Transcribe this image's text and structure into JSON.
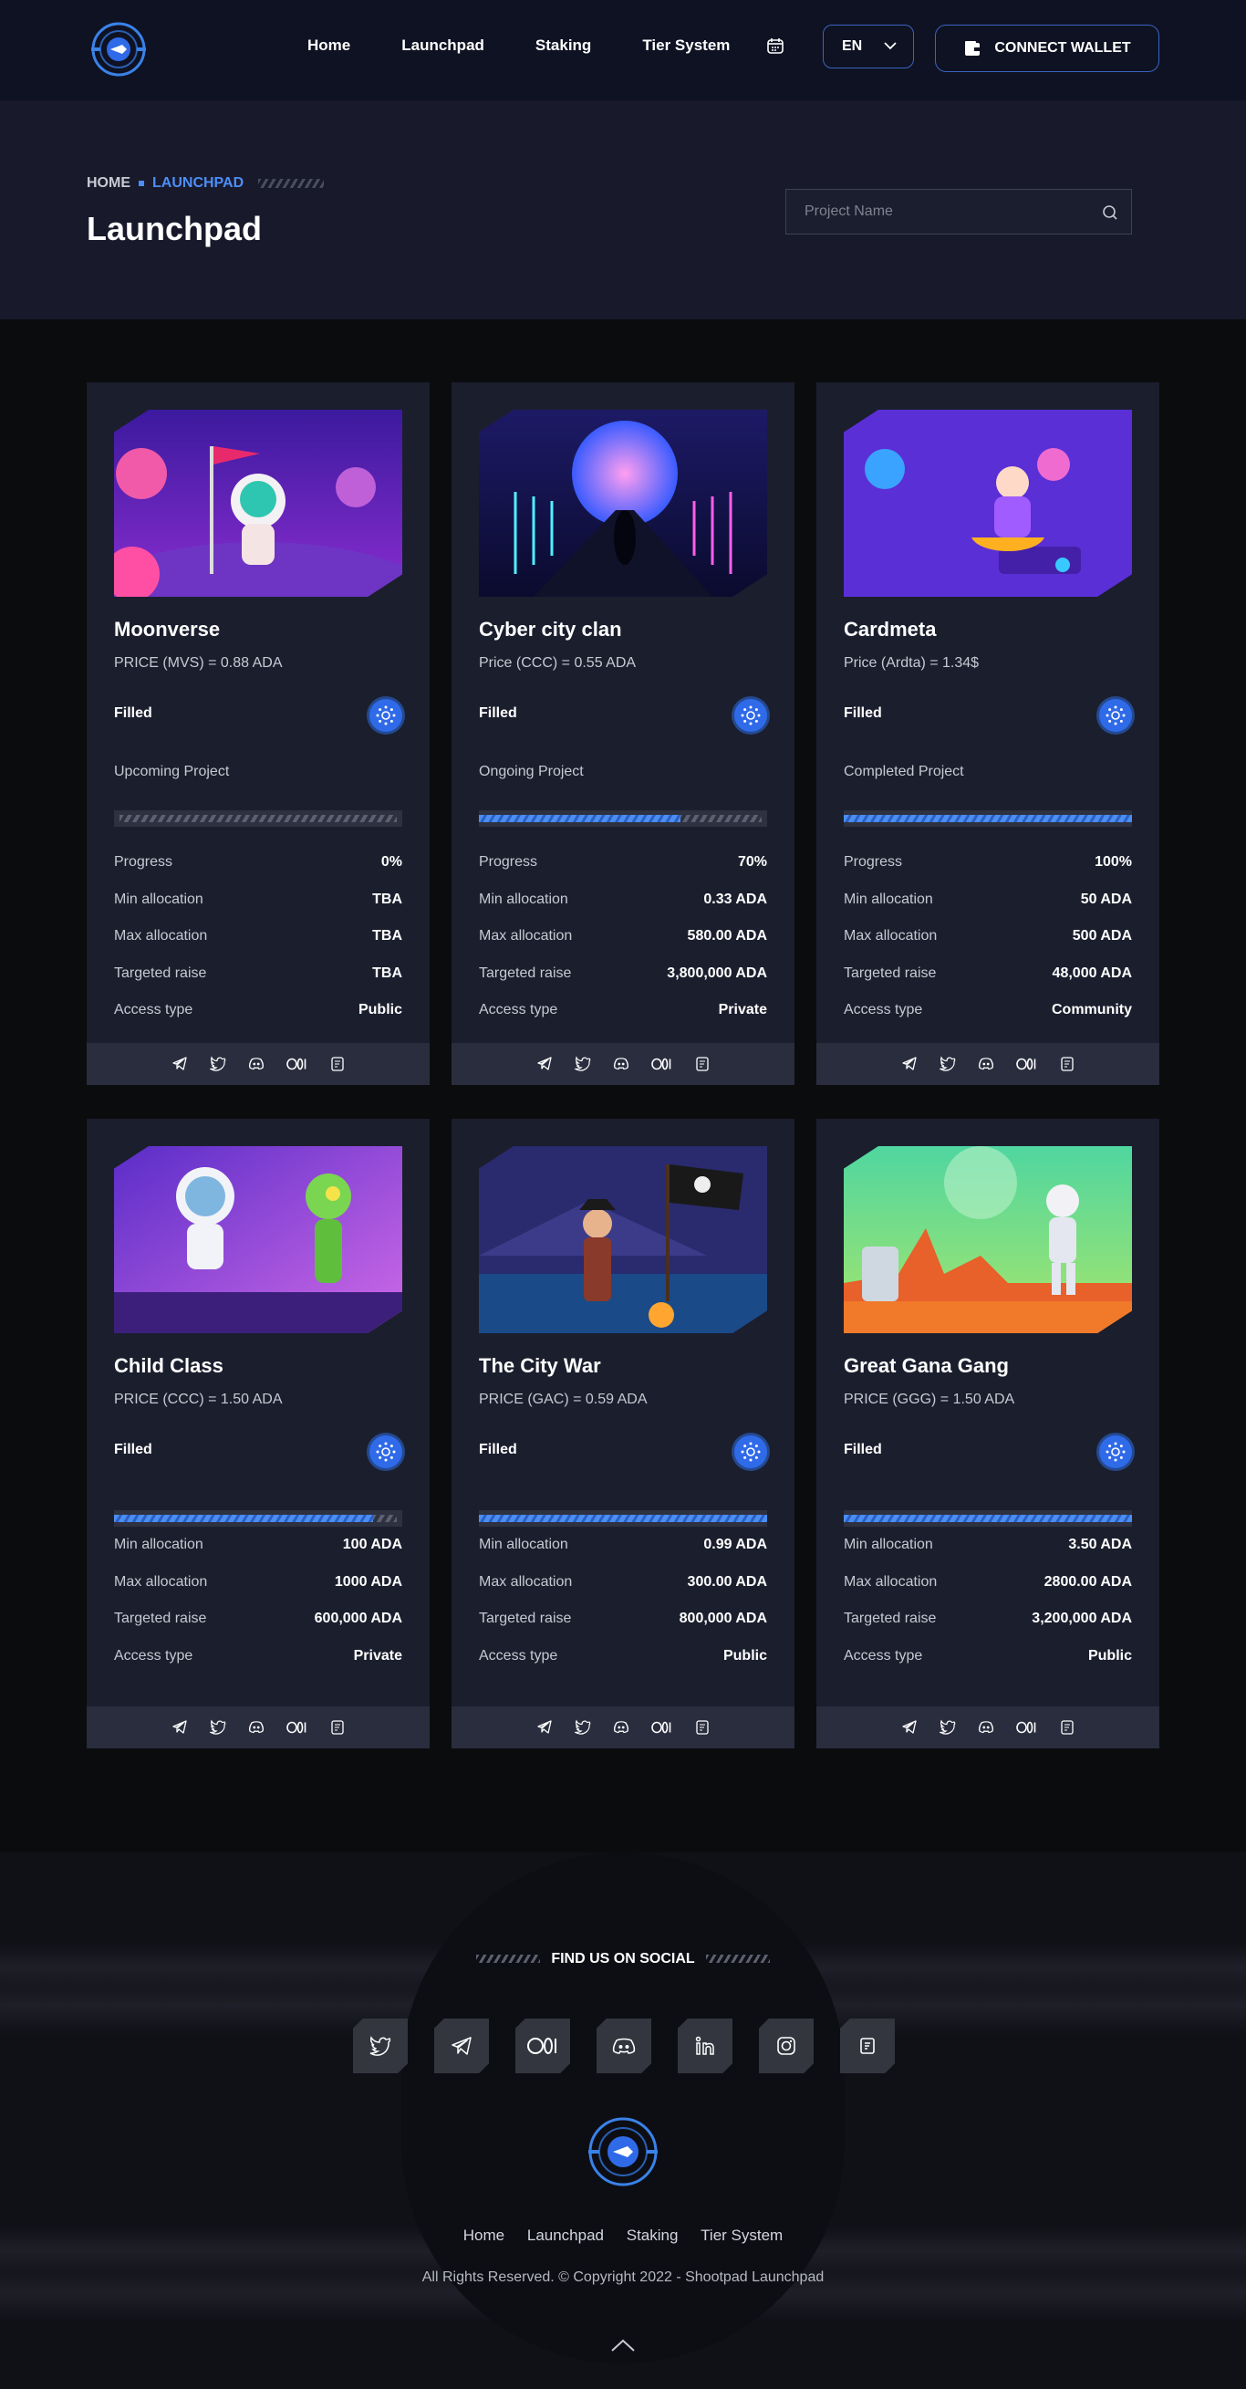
{
  "header": {
    "nav": [
      "Home",
      "Launchpad",
      "Staking",
      "Tier System"
    ],
    "language": "EN",
    "connect_wallet": "CONNECT WALLET"
  },
  "hero": {
    "breadcrumb_home": "HOME",
    "breadcrumb_current": "LAUNCHPAD",
    "title": "Launchpad",
    "search_placeholder": "Project Name"
  },
  "projects": [
    {
      "name": "Moonverse",
      "price": "PRICE (MVS) = 0.88 ADA",
      "status": "Filled",
      "phase": "Upcoming Project",
      "progress_fraction": 0.0,
      "rows": [
        [
          "Progress",
          "0%"
        ],
        [
          "Min allocation",
          "TBA"
        ],
        [
          "Max allocation",
          "TBA"
        ],
        [
          "Targeted raise",
          "TBA"
        ],
        [
          "Access type",
          "Public"
        ]
      ]
    },
    {
      "name": "Cyber city clan",
      "price": "Price (CCC) = 0.55 ADA",
      "status": "Filled",
      "phase": "Ongoing Project",
      "progress_fraction": 0.7,
      "rows": [
        [
          "Progress",
          "70%"
        ],
        [
          "Min allocation",
          "0.33 ADA"
        ],
        [
          "Max allocation",
          "580.00 ADA"
        ],
        [
          "Targeted raise",
          "3,800,000 ADA"
        ],
        [
          "Access type",
          "Private"
        ]
      ]
    },
    {
      "name": "Cardmeta",
      "price": "Price (Ardta) = 1.34$",
      "status": "Filled",
      "phase": "Completed Project",
      "progress_fraction": 1.0,
      "rows": [
        [
          "Progress",
          "100%"
        ],
        [
          "Min allocation",
          "50 ADA"
        ],
        [
          "Max allocation",
          "500 ADA"
        ],
        [
          "Targeted raise",
          "48,000 ADA"
        ],
        [
          "Access type",
          "Community"
        ]
      ]
    },
    {
      "name": "Child Class",
      "price": "PRICE (CCC) = 1.50 ADA",
      "status": "Filled",
      "phase": "",
      "progress_fraction": 0.9,
      "rows": [
        [
          "Min allocation",
          "100 ADA"
        ],
        [
          "Max allocation",
          "1000 ADA"
        ],
        [
          "Targeted raise",
          "600,000 ADA"
        ],
        [
          "Access type",
          "Private"
        ]
      ]
    },
    {
      "name": "The City War",
      "price": "PRICE (GAC) = 0.59 ADA",
      "status": "Filled",
      "phase": "",
      "progress_fraction": 1.0,
      "rows": [
        [
          "Min allocation",
          "0.99 ADA"
        ],
        [
          "Max allocation",
          "300.00 ADA"
        ],
        [
          "Targeted raise",
          "800,000 ADA"
        ],
        [
          "Access type",
          "Public"
        ]
      ]
    },
    {
      "name": "Great Gana Gang",
      "price": "PRICE (GGG) = 1.50 ADA",
      "status": "Filled",
      "phase": "",
      "progress_fraction": 1.0,
      "rows": [
        [
          "Min allocation",
          "3.50 ADA"
        ],
        [
          "Max allocation",
          "2800.00 ADA"
        ],
        [
          "Targeted raise",
          "3,200,000 ADA"
        ],
        [
          "Access type",
          "Public"
        ]
      ]
    }
  ],
  "footer": {
    "social_title": "FIND US ON SOCIAL",
    "social_icons": [
      "twitter-icon",
      "telegram-icon",
      "medium-icon",
      "discord-icon",
      "linkedin-icon",
      "instagram-icon",
      "gitbook-icon"
    ],
    "nav": [
      "Home",
      "Launchpad",
      "Staking",
      "Tier System"
    ],
    "copyright": "All Rights Reserved. © Copyright 2022 - Shootpad Launchpad"
  },
  "colors": {
    "accent": "#4d8ef7",
    "card_bg": "#1b1e2d",
    "header_bg": "#0f1222"
  }
}
